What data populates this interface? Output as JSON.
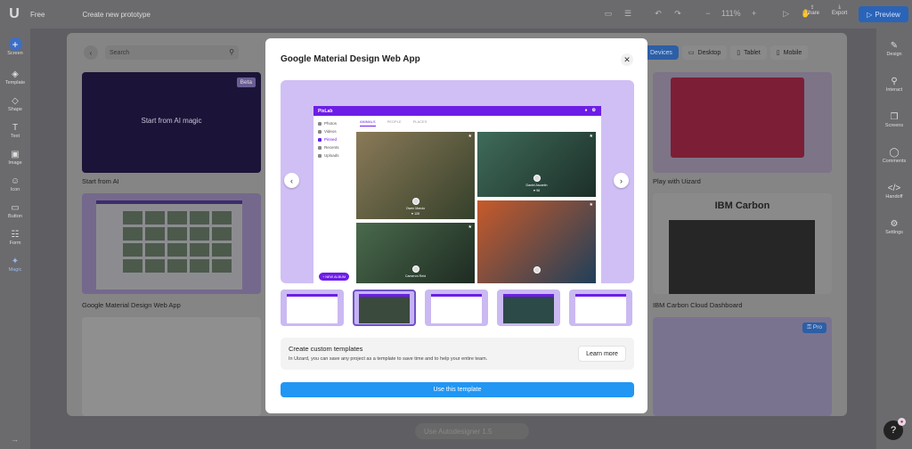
{
  "app": {
    "logo": "U",
    "plan": "Free",
    "project_title": "Create new prototype"
  },
  "topbar": {
    "zoom": "111%",
    "share_label": "Share",
    "export_label": "Export",
    "preview_label": "Preview"
  },
  "left_toolbar": [
    {
      "label": "Screen",
      "icon": "+"
    },
    {
      "label": "Template",
      "icon": "◈"
    },
    {
      "label": "Shape",
      "icon": "◇"
    },
    {
      "label": "Text",
      "icon": "T"
    },
    {
      "label": "Image",
      "icon": "▣"
    },
    {
      "label": "Icon",
      "icon": "☺"
    },
    {
      "label": "Button",
      "icon": "▭"
    },
    {
      "label": "Form",
      "icon": "☷"
    },
    {
      "label": "Magic",
      "icon": "✦"
    }
  ],
  "right_toolbar": [
    {
      "label": "Design",
      "icon": "✎"
    },
    {
      "label": "Interact",
      "icon": "⚲"
    },
    {
      "label": "Screens",
      "icon": "❐"
    },
    {
      "label": "Comments",
      "icon": "◯"
    },
    {
      "label": "Handoff",
      "icon": "</>"
    },
    {
      "label": "Settings",
      "icon": "⚙"
    }
  ],
  "picker": {
    "search_placeholder": "Search",
    "device_tabs": [
      {
        "label": "Devices",
        "icon": "▯"
      },
      {
        "label": "Desktop",
        "icon": "▭"
      },
      {
        "label": "Tablet",
        "icon": "▯"
      },
      {
        "label": "Mobile",
        "icon": "▯"
      }
    ],
    "active_tab": "Devices",
    "cards": {
      "ai": {
        "label": "Start from AI",
        "inner_text": "Start from AI magic",
        "badge": "Beta"
      },
      "gm": {
        "label": "Google Material Design Web App"
      },
      "red": {
        "label": "Play with Uizard"
      },
      "ibm": {
        "label": "IBM Carbon Cloud Dashboard",
        "inner_title": "IBM Carbon"
      },
      "pro": {
        "badge": "Pro"
      }
    }
  },
  "modal": {
    "title": "Google Material Design Web App",
    "preview": {
      "app_name": "PixLab",
      "tabs": [
        "ANIMALS",
        "PEOPLE",
        "PLACES"
      ],
      "active_tab": "ANIMALS",
      "sidebar": [
        "Photos",
        "Videos",
        "Pinned",
        "Recents",
        "Uploads"
      ],
      "active_sidebar": "Pinned",
      "new_album": "NEW ALBUM",
      "photos": [
        {
          "caption": "Owen Marulo",
          "likes": "128",
          "color1": "#8a7a58",
          "color2": "#35402a"
        },
        {
          "caption": "Daniel Ascartin",
          "likes": "98",
          "color1": "#3f6b5a",
          "color2": "#1c2f28"
        },
        {
          "caption": "Cameron Reid",
          "likes": "",
          "color1": "#4a6a4c",
          "color2": "#1e2b22"
        },
        {
          "caption": "",
          "likes": "",
          "color1": "#c85a2a",
          "color2": "#1f3f5a"
        }
      ]
    },
    "info_title": "Create custom templates",
    "info_desc": "In Uizard, you can save any project as a template to save time and to help your entire team.",
    "learn_more": "Learn more",
    "use_button": "Use this template",
    "selected_thumb": 1
  },
  "bottom_ai_placeholder": "Use Autodesigner 1.5",
  "help_label": "?",
  "colors": {
    "accent": "#2196f3",
    "app_bar": "#6d1ee6",
    "preview_bg": "#d0bff5"
  }
}
